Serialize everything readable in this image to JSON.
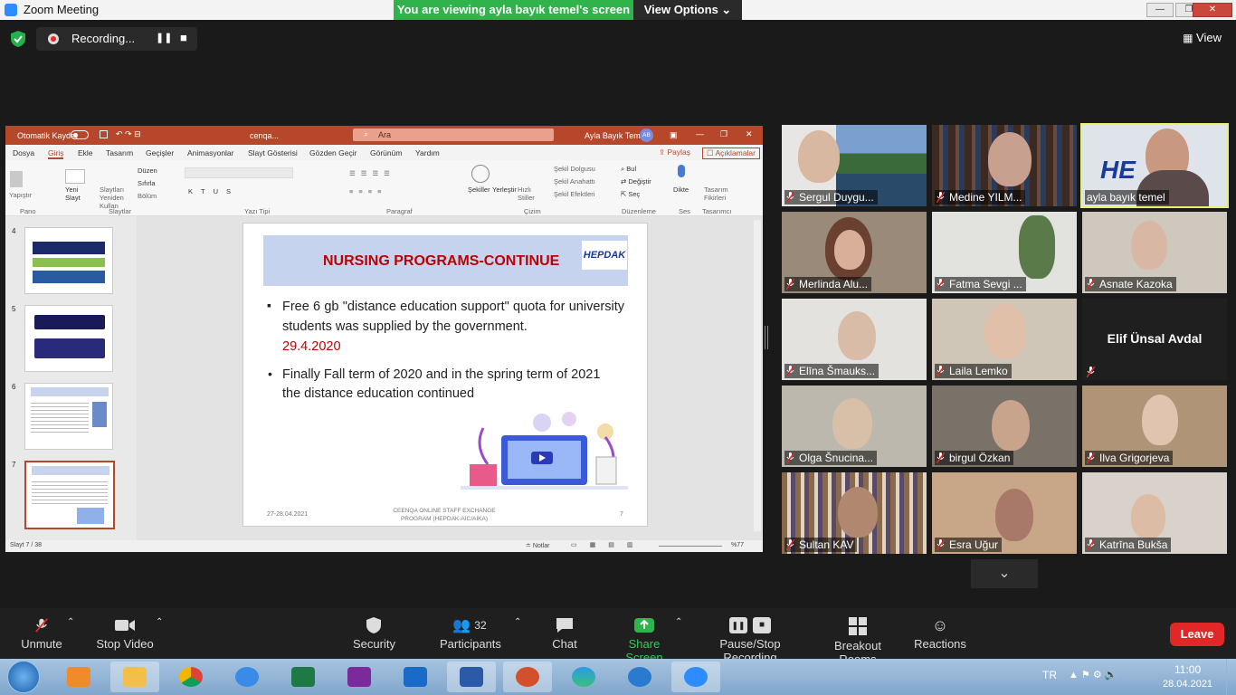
{
  "window": {
    "title": "Zoom Meeting",
    "banner": "You are viewing ayla bayık temel's screen",
    "view_options": "View Options ⌄",
    "min": "—",
    "max": "❐",
    "close": "✕"
  },
  "recording": {
    "label": "Recording...",
    "pause": "❚❚",
    "stop": "■"
  },
  "view_button": "View",
  "ppt": {
    "autosave": "Otomatik Kaydet",
    "filename": "cenqa...",
    "search": "Ara",
    "user": "Ayla Bayık Temel",
    "user_initials": "AB",
    "tabs": [
      "Dosya",
      "Giriş",
      "Ekle",
      "Tasarım",
      "Geçişler",
      "Animasyonlar",
      "Slayt Gösterisi",
      "Gözden Geçir",
      "Görünüm",
      "Yardım"
    ],
    "share": "Paylaş",
    "comments": "Açıklamalar",
    "groups": [
      "Pano",
      "Slaytlar",
      "Yazı Tipi",
      "Paragraf",
      "Çizim",
      "Düzenleme",
      "Ses",
      "Tasarımcı"
    ],
    "ribbon_items": {
      "paste": "Yapıştır",
      "new_slide": "Yeni Slayt",
      "reuse": "Slaytları Yeniden Kullan",
      "layout": "Düzen",
      "reset": "Sıfırla",
      "section": "Bölüm",
      "shapes": "Şekiller",
      "arrange": "Yerleştir",
      "quick_styles": "Hızlı Stiller",
      "fill": "Şekil Dolgusu",
      "outline": "Şekil Anahattı",
      "effects": "Şekil Efektleri",
      "find": "Bul",
      "replace": "Değiştir",
      "select": "Seç",
      "dictate": "Dikte",
      "designer": "Tasarım Fikirleri"
    },
    "thumbs": [
      {
        "num": "4"
      },
      {
        "num": "5"
      },
      {
        "num": "6"
      },
      {
        "num": "7"
      }
    ],
    "slide": {
      "title": "NURSING PROGRAMS-CONTINUE",
      "logo": "HEPDAK",
      "bullet1": "Free 6 gb \"distance education support\" quota for university students was supplied by the government.",
      "bullet1_date": "29.4.2020",
      "bullet2": "Finally Fall term of 2020 and in the spring term of 2021 the distance education continued",
      "footer_date": "27-28.04.2021",
      "footer_center": "CEENQA ONLINE STAFF EXCHANGE PROGRAM (HEPDAK-AIC/AIKA)",
      "page": "7"
    },
    "status": {
      "slide": "Slayt 7 / 38",
      "notes": "Notlar",
      "zoom": "%77"
    }
  },
  "participants": [
    {
      "name": "Sergul Duygu...",
      "bg": "#6a8bb0"
    },
    {
      "name": "Medine YILM...",
      "bg": "#4a3b30"
    },
    {
      "name": "ayla bayık temel",
      "bg": "#b0b8c8"
    },
    {
      "name": "Merlinda Alu...",
      "bg": "#7a5a48"
    },
    {
      "name": "Fatma Sevgi ...",
      "bg": "#d8d8d4"
    },
    {
      "name": "Asnate Kazoka",
      "bg": "#c9c4bc"
    },
    {
      "name": "Elīna Šmauks...",
      "bg": "#d6d2cc"
    },
    {
      "name": "Laila Lemko",
      "bg": "#c7bfb3"
    },
    {
      "name": "Elif Ünsal Avdal",
      "bg": "#1f1f1f"
    },
    {
      "name": "Olga Šnucina...",
      "bg": "#b8b3a8"
    },
    {
      "name": "birgul Özkan",
      "bg": "#8a8072"
    },
    {
      "name": "Ilva Grigorjeva",
      "bg": "#b39c86"
    },
    {
      "name": "Sultan KAV",
      "bg": "#9a8468"
    },
    {
      "name": "Esra Uğur",
      "bg": "#c4a48a"
    },
    {
      "name": "Katrīna Bukša",
      "bg": "#d4ccc4"
    }
  ],
  "toolbar": {
    "unmute": "Unmute",
    "stop_video": "Stop Video",
    "security": "Security",
    "participants": "Participants",
    "participants_count": "32",
    "chat": "Chat",
    "share": "Share Screen",
    "pause_rec": "Pause/Stop Recording",
    "breakout": "Breakout Rooms",
    "reactions": "Reactions",
    "leave": "Leave"
  },
  "taskbar": {
    "lang": "TR",
    "time": "11:00",
    "date": "28.04.2021"
  }
}
